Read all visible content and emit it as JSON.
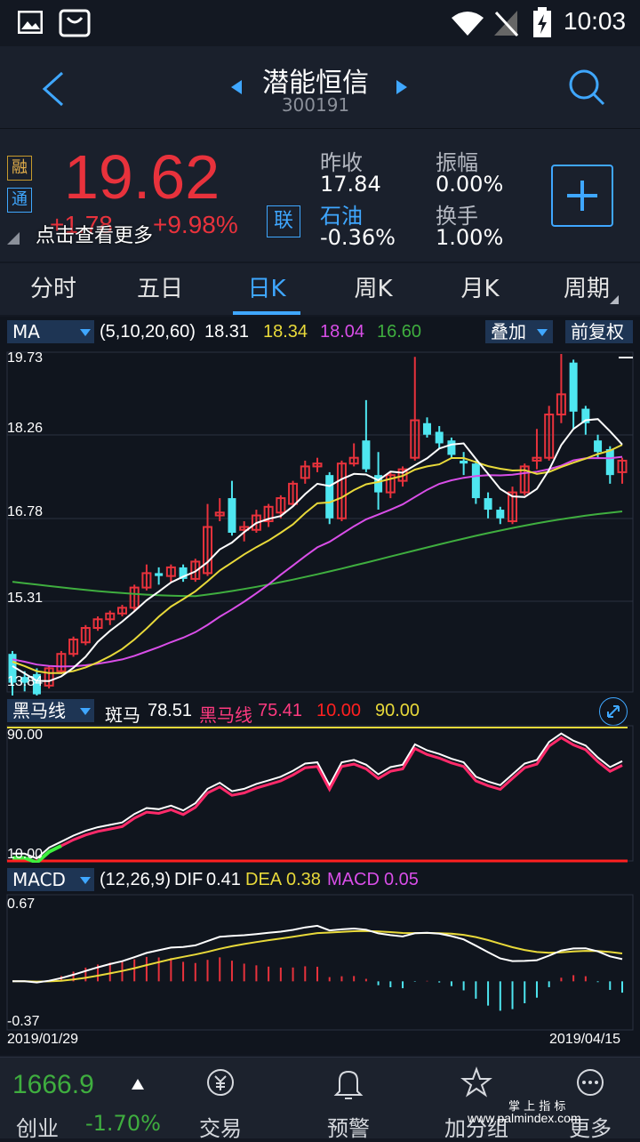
{
  "status": {
    "time": "10:03"
  },
  "header": {
    "title": "潜能恒信",
    "code": "300191"
  },
  "quote": {
    "badge_rong": "融",
    "badge_tong": "通",
    "price": "19.62",
    "change": "+1.78",
    "change_pct": "+9.98%",
    "more_text": "点击查看更多",
    "lian": "联",
    "prev_close_label": "昨收",
    "prev_close": "17.84",
    "amplitude_label": "振幅",
    "amplitude": "0.00%",
    "sector_label": "石油",
    "sector_change": "-0.36%",
    "turnover_label": "换手",
    "turnover": "1.00%"
  },
  "tabs": [
    "分时",
    "五日",
    "日K",
    "周K",
    "月K",
    "周期"
  ],
  "ma": {
    "name": "MA",
    "params": "(5,10,20,60)",
    "v1": "18.31",
    "v2": "18.34",
    "v3": "18.04",
    "v4": "16.60",
    "overlay": "叠加",
    "adjust": "前复权"
  },
  "price_axis": [
    "19.73",
    "18.26",
    "16.78",
    "15.31",
    "13.84"
  ],
  "zebra": {
    "name": "黑马线",
    "label1": "斑马",
    "v1": "78.51",
    "label2": "黑马线",
    "v2": "75.41",
    "v3": "10.00",
    "v4": "90.00",
    "axis_top": "90.00",
    "axis_bottom": "10.00"
  },
  "macd": {
    "name": "MACD",
    "params": "(12,26,9)",
    "dif_label": "DIF",
    "dif": "0.41",
    "dea_label": "DEA",
    "dea": "0.38",
    "macd_label": "MACD",
    "macd": "0.05",
    "axis_top": "0.67",
    "axis_bottom": "-0.37"
  },
  "dates": {
    "start": "2019/01/29",
    "end": "2019/04/15"
  },
  "bottom": {
    "index_value": "1666.9",
    "index_name": "创业",
    "index_change": "-1.70%",
    "nav": [
      "交易",
      "预警",
      "加分组",
      "更多"
    ],
    "watermark": "掌 上 指 标",
    "watermark_url": "www.palmindex.com"
  },
  "colors": {
    "up": "#e8323c",
    "down": "#4ee6f0",
    "accent": "#3fa7ff",
    "ma5": "#ffffff",
    "ma10": "#e8d93a",
    "ma20": "#d94ee8",
    "ma60": "#3fae3f"
  },
  "chart_data": {
    "type": "candlestick",
    "candles": [
      [
        14.5,
        14.0,
        14.55,
        13.6
      ],
      [
        14.1,
        14.0,
        14.2,
        13.85
      ],
      [
        14.15,
        13.8,
        14.25,
        13.75
      ],
      [
        13.95,
        14.25,
        14.3,
        13.9
      ],
      [
        14.2,
        14.5,
        14.55,
        14.15
      ],
      [
        14.5,
        14.75,
        14.8,
        14.45
      ],
      [
        14.7,
        14.95,
        15.0,
        14.65
      ],
      [
        14.95,
        15.1,
        15.15,
        14.9
      ],
      [
        15.1,
        15.2,
        15.25,
        15.0
      ],
      [
        15.2,
        15.3,
        15.35,
        15.15
      ],
      [
        15.3,
        15.65,
        15.7,
        15.25
      ],
      [
        15.65,
        15.9,
        16.05,
        15.6
      ],
      [
        15.9,
        15.85,
        16.0,
        15.7
      ],
      [
        15.85,
        16.0,
        16.05,
        15.75
      ],
      [
        16.0,
        15.8,
        16.05,
        15.75
      ],
      [
        15.8,
        16.1,
        16.15,
        15.75
      ],
      [
        15.9,
        16.7,
        17.1,
        15.85
      ],
      [
        16.9,
        16.95,
        17.2,
        16.8
      ],
      [
        17.2,
        16.6,
        17.5,
        16.55
      ],
      [
        16.65,
        16.7,
        16.8,
        16.45
      ],
      [
        16.65,
        16.9,
        17.0,
        16.6
      ],
      [
        16.8,
        17.05,
        17.1,
        16.7
      ],
      [
        16.95,
        17.2,
        17.25,
        16.85
      ],
      [
        17.1,
        17.45,
        17.5,
        17.05
      ],
      [
        17.55,
        17.75,
        17.85,
        17.45
      ],
      [
        17.75,
        17.8,
        17.9,
        17.65
      ],
      [
        17.6,
        16.85,
        17.65,
        16.75
      ],
      [
        16.85,
        17.8,
        17.85,
        16.8
      ],
      [
        17.8,
        17.9,
        18.15,
        17.75
      ],
      [
        18.2,
        17.7,
        18.9,
        17.65
      ],
      [
        17.6,
        17.3,
        18.0,
        17.0
      ],
      [
        17.3,
        17.6,
        17.65,
        17.2
      ],
      [
        17.5,
        17.7,
        17.75,
        17.4
      ],
      [
        17.9,
        18.55,
        19.65,
        17.85
      ],
      [
        18.5,
        18.3,
        18.6,
        18.25
      ],
      [
        18.35,
        18.15,
        18.45,
        18.05
      ],
      [
        18.2,
        17.95,
        18.25,
        17.9
      ],
      [
        17.85,
        17.8,
        18.0,
        17.6
      ],
      [
        17.8,
        17.2,
        17.85,
        17.1
      ],
      [
        17.2,
        17.0,
        17.3,
        16.85
      ],
      [
        17.0,
        16.85,
        17.05,
        16.75
      ],
      [
        16.8,
        17.3,
        17.4,
        16.75
      ],
      [
        17.3,
        17.75,
        17.8,
        17.25
      ],
      [
        17.85,
        17.9,
        18.4,
        17.7
      ],
      [
        17.9,
        18.65,
        18.8,
        17.85
      ],
      [
        18.65,
        19.0,
        19.7,
        18.5
      ],
      [
        19.55,
        18.7,
        19.6,
        18.4
      ],
      [
        18.75,
        18.5,
        18.8,
        18.3
      ],
      [
        18.2,
        18.0,
        18.3,
        17.9
      ],
      [
        18.05,
        17.6,
        18.1,
        17.45
      ],
      [
        17.65,
        17.85,
        17.9,
        17.45
      ]
    ],
    "zebra_range": [
      10,
      90
    ],
    "macd_range": [
      -0.37,
      0.67
    ]
  }
}
